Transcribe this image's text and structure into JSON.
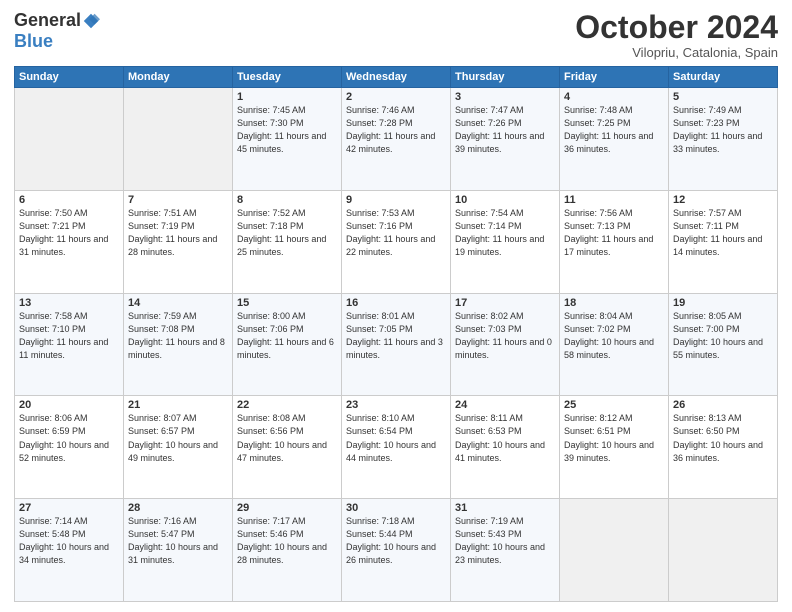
{
  "header": {
    "logo_general": "General",
    "logo_blue": "Blue",
    "month_title": "October 2024",
    "location": "Vilopriu, Catalonia, Spain"
  },
  "weekdays": [
    "Sunday",
    "Monday",
    "Tuesday",
    "Wednesday",
    "Thursday",
    "Friday",
    "Saturday"
  ],
  "weeks": [
    [
      {
        "day": "",
        "info": ""
      },
      {
        "day": "",
        "info": ""
      },
      {
        "day": "1",
        "info": "Sunrise: 7:45 AM\nSunset: 7:30 PM\nDaylight: 11 hours and 45 minutes."
      },
      {
        "day": "2",
        "info": "Sunrise: 7:46 AM\nSunset: 7:28 PM\nDaylight: 11 hours and 42 minutes."
      },
      {
        "day": "3",
        "info": "Sunrise: 7:47 AM\nSunset: 7:26 PM\nDaylight: 11 hours and 39 minutes."
      },
      {
        "day": "4",
        "info": "Sunrise: 7:48 AM\nSunset: 7:25 PM\nDaylight: 11 hours and 36 minutes."
      },
      {
        "day": "5",
        "info": "Sunrise: 7:49 AM\nSunset: 7:23 PM\nDaylight: 11 hours and 33 minutes."
      }
    ],
    [
      {
        "day": "6",
        "info": "Sunrise: 7:50 AM\nSunset: 7:21 PM\nDaylight: 11 hours and 31 minutes."
      },
      {
        "day": "7",
        "info": "Sunrise: 7:51 AM\nSunset: 7:19 PM\nDaylight: 11 hours and 28 minutes."
      },
      {
        "day": "8",
        "info": "Sunrise: 7:52 AM\nSunset: 7:18 PM\nDaylight: 11 hours and 25 minutes."
      },
      {
        "day": "9",
        "info": "Sunrise: 7:53 AM\nSunset: 7:16 PM\nDaylight: 11 hours and 22 minutes."
      },
      {
        "day": "10",
        "info": "Sunrise: 7:54 AM\nSunset: 7:14 PM\nDaylight: 11 hours and 19 minutes."
      },
      {
        "day": "11",
        "info": "Sunrise: 7:56 AM\nSunset: 7:13 PM\nDaylight: 11 hours and 17 minutes."
      },
      {
        "day": "12",
        "info": "Sunrise: 7:57 AM\nSunset: 7:11 PM\nDaylight: 11 hours and 14 minutes."
      }
    ],
    [
      {
        "day": "13",
        "info": "Sunrise: 7:58 AM\nSunset: 7:10 PM\nDaylight: 11 hours and 11 minutes."
      },
      {
        "day": "14",
        "info": "Sunrise: 7:59 AM\nSunset: 7:08 PM\nDaylight: 11 hours and 8 minutes."
      },
      {
        "day": "15",
        "info": "Sunrise: 8:00 AM\nSunset: 7:06 PM\nDaylight: 11 hours and 6 minutes."
      },
      {
        "day": "16",
        "info": "Sunrise: 8:01 AM\nSunset: 7:05 PM\nDaylight: 11 hours and 3 minutes."
      },
      {
        "day": "17",
        "info": "Sunrise: 8:02 AM\nSunset: 7:03 PM\nDaylight: 11 hours and 0 minutes."
      },
      {
        "day": "18",
        "info": "Sunrise: 8:04 AM\nSunset: 7:02 PM\nDaylight: 10 hours and 58 minutes."
      },
      {
        "day": "19",
        "info": "Sunrise: 8:05 AM\nSunset: 7:00 PM\nDaylight: 10 hours and 55 minutes."
      }
    ],
    [
      {
        "day": "20",
        "info": "Sunrise: 8:06 AM\nSunset: 6:59 PM\nDaylight: 10 hours and 52 minutes."
      },
      {
        "day": "21",
        "info": "Sunrise: 8:07 AM\nSunset: 6:57 PM\nDaylight: 10 hours and 49 minutes."
      },
      {
        "day": "22",
        "info": "Sunrise: 8:08 AM\nSunset: 6:56 PM\nDaylight: 10 hours and 47 minutes."
      },
      {
        "day": "23",
        "info": "Sunrise: 8:10 AM\nSunset: 6:54 PM\nDaylight: 10 hours and 44 minutes."
      },
      {
        "day": "24",
        "info": "Sunrise: 8:11 AM\nSunset: 6:53 PM\nDaylight: 10 hours and 41 minutes."
      },
      {
        "day": "25",
        "info": "Sunrise: 8:12 AM\nSunset: 6:51 PM\nDaylight: 10 hours and 39 minutes."
      },
      {
        "day": "26",
        "info": "Sunrise: 8:13 AM\nSunset: 6:50 PM\nDaylight: 10 hours and 36 minutes."
      }
    ],
    [
      {
        "day": "27",
        "info": "Sunrise: 7:14 AM\nSunset: 5:48 PM\nDaylight: 10 hours and 34 minutes."
      },
      {
        "day": "28",
        "info": "Sunrise: 7:16 AM\nSunset: 5:47 PM\nDaylight: 10 hours and 31 minutes."
      },
      {
        "day": "29",
        "info": "Sunrise: 7:17 AM\nSunset: 5:46 PM\nDaylight: 10 hours and 28 minutes."
      },
      {
        "day": "30",
        "info": "Sunrise: 7:18 AM\nSunset: 5:44 PM\nDaylight: 10 hours and 26 minutes."
      },
      {
        "day": "31",
        "info": "Sunrise: 7:19 AM\nSunset: 5:43 PM\nDaylight: 10 hours and 23 minutes."
      },
      {
        "day": "",
        "info": ""
      },
      {
        "day": "",
        "info": ""
      }
    ]
  ]
}
